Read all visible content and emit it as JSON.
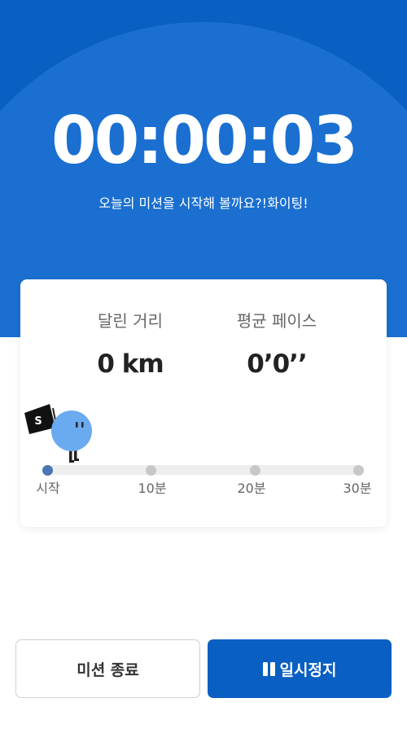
{
  "colors": {
    "primary": "#0a5fc2",
    "primary_light": "#1a6fd0",
    "mascot": "#6aaaf0",
    "track": "#eeeeee",
    "dot_active": "#4a77b4",
    "dot_inactive": "#c7c7c7"
  },
  "hero": {
    "timer": "00:00:03",
    "message": "오늘의 미션을 시작해 볼까요?!화이팅!"
  },
  "stats": {
    "distance": {
      "label": "달린 거리",
      "value": "0 km"
    },
    "pace": {
      "label": "평균 페이스",
      "value": "0’0’’"
    }
  },
  "mascot": {
    "icon": "mascot-with-flag-icon",
    "flag_letter": "S"
  },
  "progress": {
    "fraction": 0,
    "ticks": [
      "시작",
      "10분",
      "20분",
      "30분"
    ]
  },
  "buttons": {
    "end_label": "미션 종료",
    "pause_label": "일시정지",
    "pause_icon": "pause-icon"
  }
}
